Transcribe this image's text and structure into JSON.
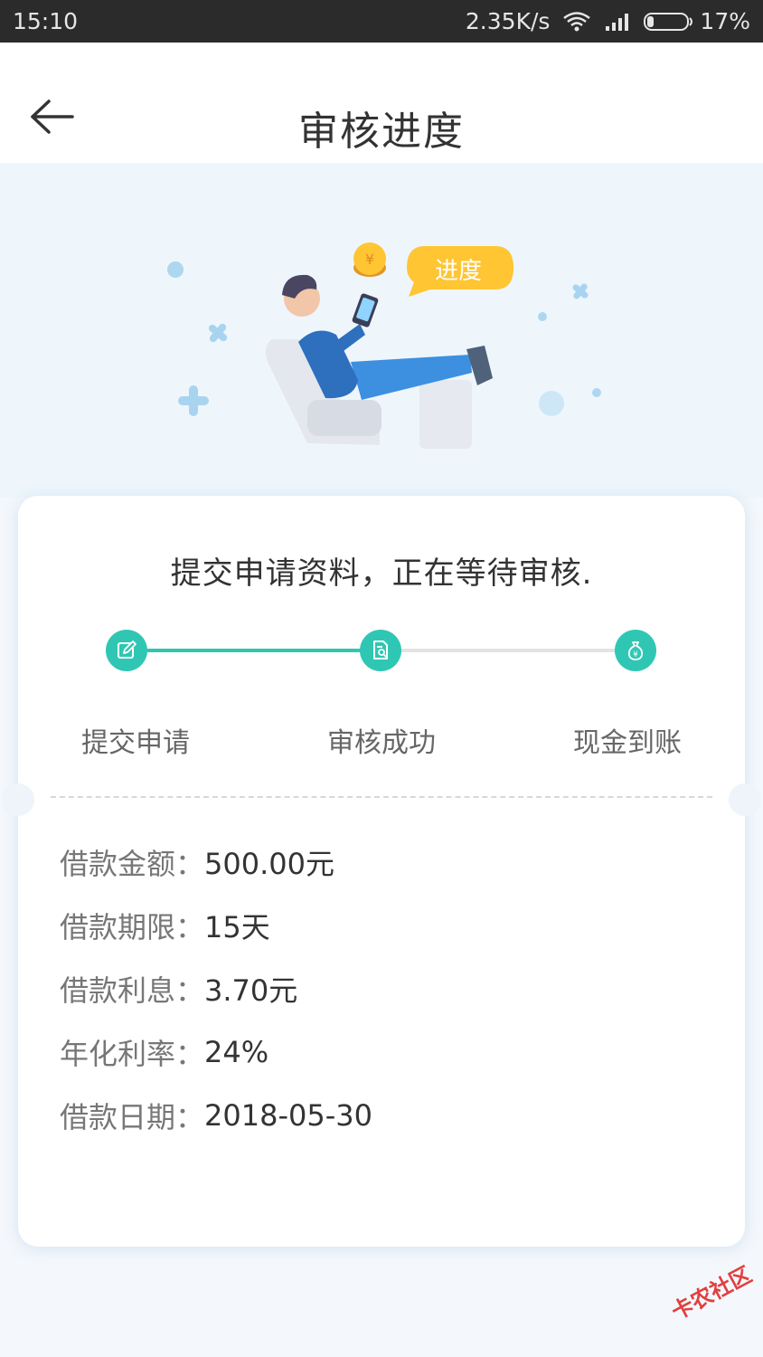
{
  "status_bar": {
    "time": "15:10",
    "speed": "2.35K/s",
    "battery": "17%",
    "icons": [
      "wifi-icon",
      "signal-icon",
      "battery-icon"
    ]
  },
  "header": {
    "title": "审核进度",
    "back_icon": "arrow-left-icon"
  },
  "hero": {
    "bubble_text": "进度",
    "coin_symbol": "¥"
  },
  "card": {
    "status_message": "提交申请资料，正在等待审核.",
    "steps": [
      {
        "label": "提交申请",
        "icon": "edit-icon",
        "state": "done"
      },
      {
        "label": "审核成功",
        "icon": "document-search-icon",
        "state": "current"
      },
      {
        "label": "现金到账",
        "icon": "money-bag-icon",
        "state": "pending"
      }
    ],
    "details": [
      {
        "label": "借款金额：",
        "value": "500.00元"
      },
      {
        "label": "借款期限：",
        "value": "15天"
      },
      {
        "label": "借款利息：",
        "value": "3.70元"
      },
      {
        "label": "年化利率：",
        "value": "24%"
      },
      {
        "label": "借款日期：",
        "value": "2018-05-30"
      }
    ]
  },
  "watermark": "卡农社区",
  "colors": {
    "accent": "#2fc7b3",
    "bubble": "#ffc533",
    "hero_bg": "#eef6fc"
  }
}
